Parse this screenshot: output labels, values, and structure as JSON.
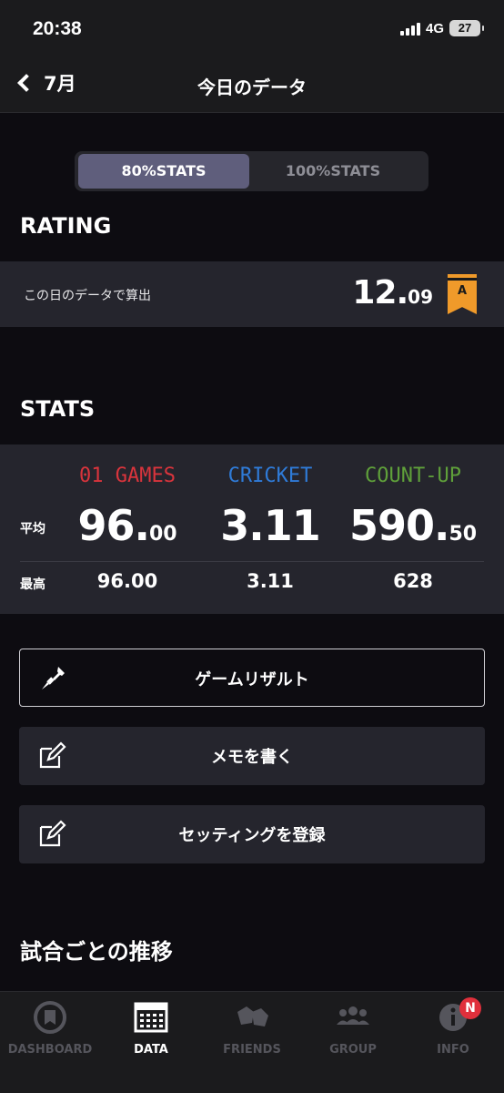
{
  "status": {
    "time": "20:38",
    "network": "4G",
    "battery": "27"
  },
  "nav": {
    "back_label": "7月",
    "title": "今日のデータ"
  },
  "segment": {
    "options": [
      "80%STATS",
      "100%STATS"
    ],
    "selected": "80%STATS"
  },
  "rating": {
    "section_title": "RATING",
    "label": "この日のデータで算出",
    "value_int": "12.",
    "value_dec": "09",
    "rank": "A",
    "rank_color": "#f09a2a"
  },
  "stats": {
    "section_title": "STATS",
    "columns": [
      {
        "name": "01 GAMES",
        "color": "#d9343c",
        "avg_int": "96.",
        "avg_dec": "00",
        "max": "96.00"
      },
      {
        "name": "CRICKET",
        "color": "#2f7bd8",
        "avg_int": "3.11",
        "avg_dec": "",
        "max": "3.11"
      },
      {
        "name": "COUNT-UP",
        "color": "#5fa03a",
        "avg_int": "590.",
        "avg_dec": "50",
        "max": "628"
      }
    ],
    "row_avg_label": "平均",
    "row_max_label": "最高"
  },
  "actions": {
    "game_result": "ゲームリザルト",
    "write_memo": "メモを書く",
    "register_setting": "セッティングを登録"
  },
  "trend": {
    "section_title": "試合ごとの推移"
  },
  "tabs": [
    {
      "label": "DASHBOARD",
      "icon": "dartboard-icon"
    },
    {
      "label": "DATA",
      "icon": "data-grid-icon",
      "active": true
    },
    {
      "label": "FRIENDS",
      "icon": "friends-icon"
    },
    {
      "label": "GROUP",
      "icon": "group-icon"
    },
    {
      "label": "INFO",
      "icon": "info-icon",
      "badge": "N"
    }
  ]
}
